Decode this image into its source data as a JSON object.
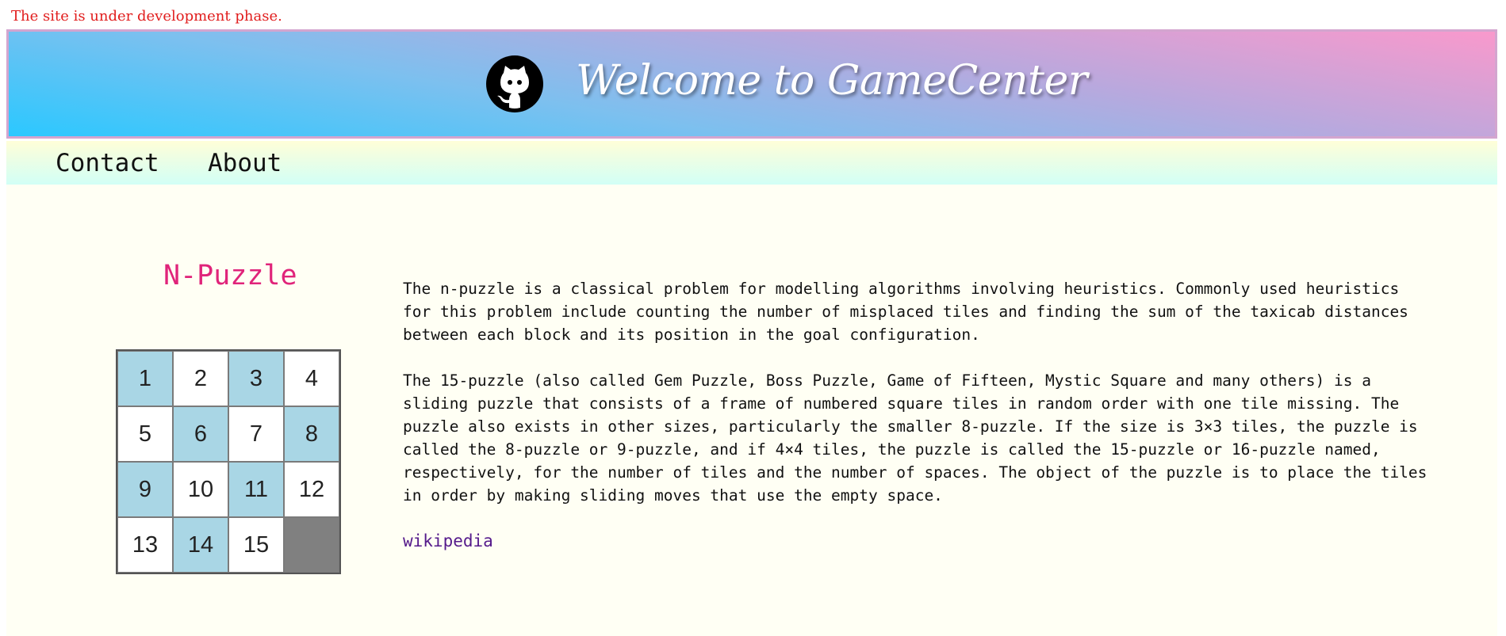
{
  "notice": "The site is under development phase.",
  "header": {
    "logo_icon": "github-octocat-icon",
    "title": "Welcome to GameCenter"
  },
  "nav": {
    "items": [
      {
        "label": "Contact"
      },
      {
        "label": "About"
      }
    ]
  },
  "main": {
    "puzzle_title": "N-Puzzle",
    "board": {
      "tiles": [
        {
          "label": "1",
          "style": "blue"
        },
        {
          "label": "2",
          "style": "white"
        },
        {
          "label": "3",
          "style": "blue"
        },
        {
          "label": "4",
          "style": "white"
        },
        {
          "label": "5",
          "style": "white"
        },
        {
          "label": "6",
          "style": "blue"
        },
        {
          "label": "7",
          "style": "white"
        },
        {
          "label": "8",
          "style": "blue"
        },
        {
          "label": "9",
          "style": "blue"
        },
        {
          "label": "10",
          "style": "white"
        },
        {
          "label": "11",
          "style": "blue"
        },
        {
          "label": "12",
          "style": "white"
        },
        {
          "label": "13",
          "style": "white"
        },
        {
          "label": "14",
          "style": "blue"
        },
        {
          "label": "15",
          "style": "white"
        },
        {
          "label": "",
          "style": "empty"
        }
      ],
      "colors": {
        "blue": "#a9d6e5",
        "white": "#ffffff",
        "empty": "#808080"
      }
    },
    "paragraphs": [
      "The n-puzzle is a classical problem for modelling algorithms involving heuristics. Commonly used heuristics for this problem include counting the number of misplaced tiles and finding the sum of the taxicab distances between each block and its position in the goal configuration.",
      "The 15-puzzle (also called Gem Puzzle, Boss Puzzle, Game of Fifteen, Mystic Square and many others) is a sliding puzzle that consists of a frame of numbered square tiles in random order with one tile missing. The puzzle also exists in other sizes, particularly the smaller 8-puzzle. If the size is 3×3 tiles, the puzzle is called the 8-puzzle or 9-puzzle, and if 4×4 tiles, the puzzle is called the 15-puzzle or 16-puzzle named, respectively, for the number of tiles and the number of spaces. The object of the puzzle is to place the tiles in order by making sliding moves that use the empty space."
    ],
    "link_label": "wikipedia"
  },
  "colors": {
    "notice": "#e11d1d",
    "puzzle_title": "#e0247a",
    "link": "#551a8b"
  }
}
